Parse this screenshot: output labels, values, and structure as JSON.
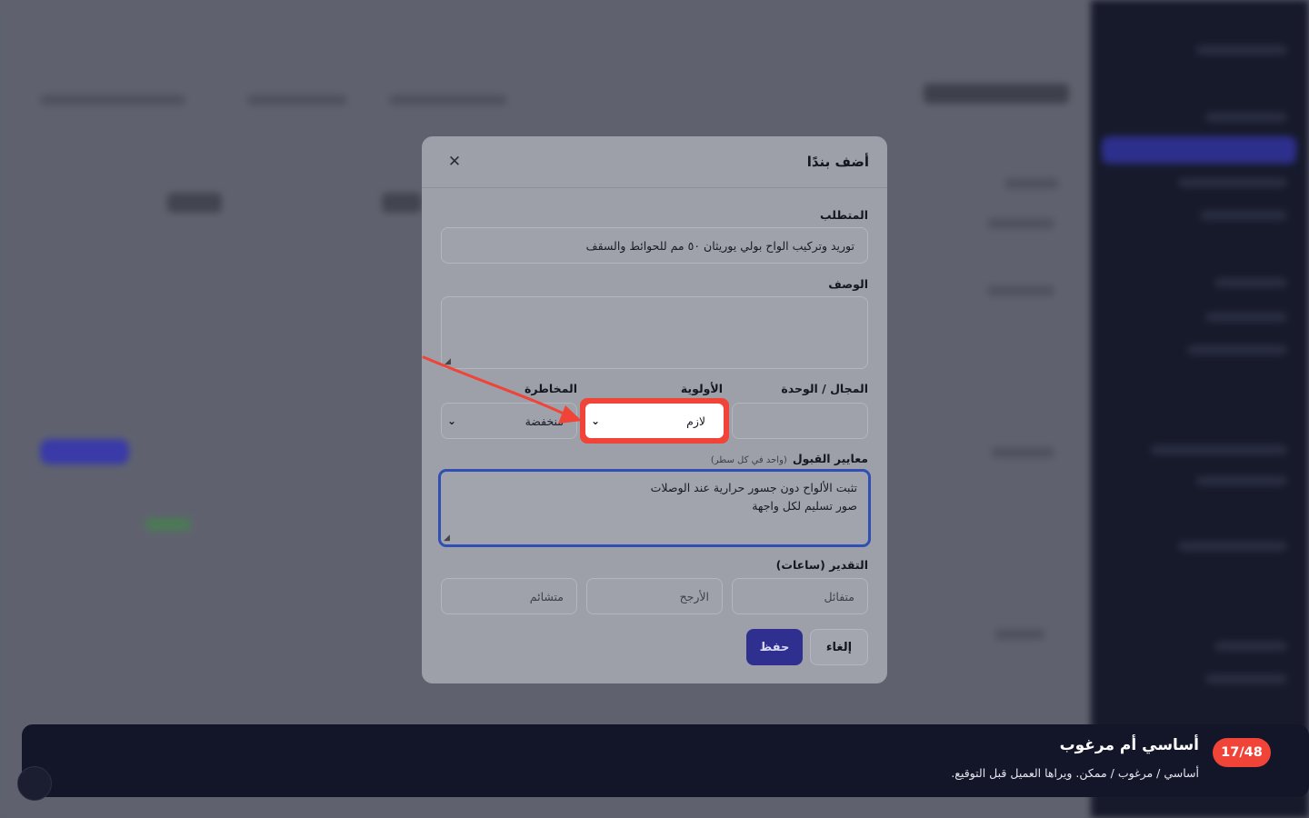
{
  "modal": {
    "title": "أضف بندًا",
    "close_icon": "close-icon",
    "requirement": {
      "label": "المتطلب",
      "value": "توريد وتركيب الواح بولي يوريثان ٥٠ مم للحوائط والسقف"
    },
    "description": {
      "label": "الوصف",
      "value": ""
    },
    "area": {
      "label": "المجال / الوحدة",
      "value": ""
    },
    "priority": {
      "label": "الأولوية",
      "value": "لازم"
    },
    "risk": {
      "label": "المخاطرة",
      "value": "منخفضة"
    },
    "criteria": {
      "label": "معايير القبول",
      "hint": "(واحد في كل سطر)",
      "lines": [
        "تثبت الألواح دون جسور حرارية عند الوصلات",
        "صور تسليم لكل واجهة"
      ]
    },
    "estimate": {
      "label": "التقدير (ساعات)",
      "optimistic_placeholder": "متفائل",
      "likely_placeholder": "الأرجح",
      "pessimistic_placeholder": "متشائم"
    },
    "save_label": "حفظ",
    "cancel_label": "إلغاء"
  },
  "tour": {
    "step": "17/48",
    "title": "أساسي أم مرغوب",
    "text": "أساسي / مرغوب / ممكن. ويراها العميل قبل التوقيع."
  },
  "colors": {
    "accent": "#2e2f8f",
    "highlight": "#f04438",
    "focus": "#2f4fb4",
    "tour_bg": "#131629"
  }
}
